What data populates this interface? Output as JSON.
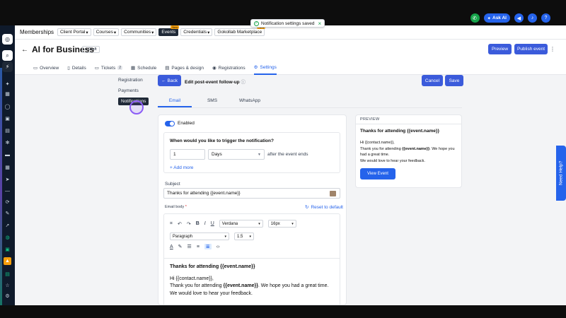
{
  "toast": {
    "message": "Notification settings saved"
  },
  "topbar": {
    "ask_ai_label": "Ask AI",
    "help_label": "?"
  },
  "nav": {
    "brand": "Memberships",
    "items": [
      {
        "label": "Client Portal"
      },
      {
        "label": "Courses"
      },
      {
        "label": "Communities"
      },
      {
        "label": "Events",
        "badge": "New"
      },
      {
        "label": "Credentials"
      },
      {
        "label": "Gokollab Marketplace",
        "badge": "New"
      }
    ]
  },
  "header": {
    "title": "AI for Business",
    "status": "Draft",
    "preview_label": "Preview",
    "publish_label": "Publish event",
    "more": "⋮",
    "tabs": [
      {
        "label": "Overview"
      },
      {
        "label": "Details"
      },
      {
        "label": "Tickets",
        "count": "2"
      },
      {
        "label": "Schedule"
      },
      {
        "label": "Pages & design"
      },
      {
        "label": "Registrations"
      },
      {
        "label": "Settings"
      }
    ]
  },
  "settings_nav": [
    "Registration",
    "Payments",
    "Notifications"
  ],
  "editor_bar": {
    "back_label": "Back",
    "title": "Edit post-event follow-up",
    "cancel_label": "Cancel",
    "save_label": "Save"
  },
  "channels": [
    "Email",
    "SMS",
    "WhatsApp"
  ],
  "form": {
    "enabled_label": "Enabled",
    "trigger_question": "When would you like to trigger the notification?",
    "amount": "1",
    "unit": "Days",
    "after_text": "after the event ends",
    "add_more": "+ Add more",
    "subject_label": "Subject",
    "subject_value": "Thanks for attending {{event.name}}",
    "email_body_label": "Email body",
    "required_mark": "*",
    "reset_label": "Reset to default"
  },
  "toolbar": {
    "font": "Verdana",
    "size": "16px",
    "block": "Paragraph",
    "line_height": "1.5"
  },
  "body": {
    "heading": "Thanks for attending {{event.name}}",
    "greeting": "Hi {{contact.name}},",
    "line1_pre": "Thank you for attending ",
    "line1_bold": "{{event.name}}",
    "line1_post": ". We hope you had a great time.",
    "line2": "We would love to hear your feedback."
  },
  "preview": {
    "heading": "PREVIEW",
    "title": "Thanks for attending {{event.name}}",
    "greeting": "Hi {{contact.name}},",
    "line1_pre": "Thank you for attending ",
    "line1_bold": "{{event.name}}",
    "line1_post": ". We hope you had a great time.",
    "line2": "We would love to hear your feedback.",
    "button": "View Event"
  },
  "need_help": "Need Help?",
  "colors": {
    "accent": "#3b5bdb",
    "link": "#2563eb",
    "sidebar": "#0f1a2b"
  }
}
